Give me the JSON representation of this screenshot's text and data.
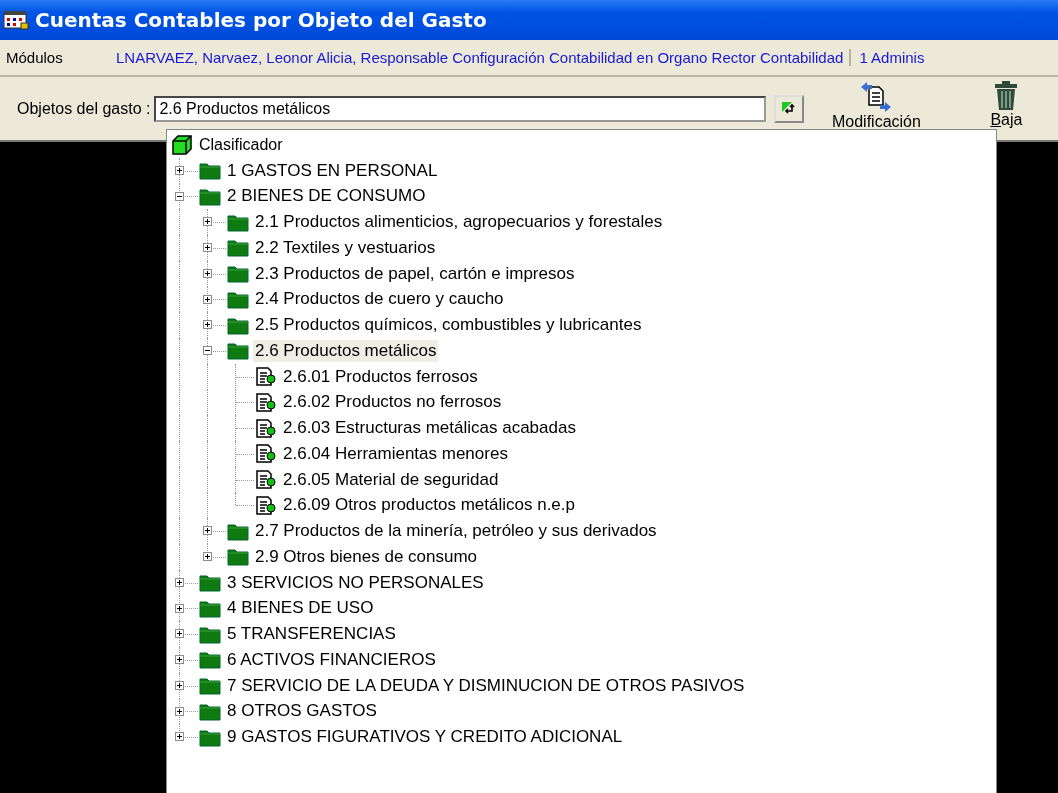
{
  "window": {
    "title": "Cuentas Contables por Objeto del Gasto"
  },
  "menu_bar": {
    "menu": "Módulos",
    "user": "LNARVAEZ, Narvaez, Leonor Alicia, Responsable Configuración Contabilidad en Organo Rector Contabilidad",
    "role": "1 Adminis"
  },
  "toolbar": {
    "field_label": "Objetos del gasto :",
    "field_value": "2.6 Productos metálicos",
    "buttons": [
      {
        "label": "Modificación",
        "kind": "edit"
      },
      {
        "label": "Baja",
        "kind": "delete"
      }
    ]
  },
  "tree": {
    "label": "Clasificador",
    "kind": "root",
    "selected": false,
    "children": [
      {
        "label": "1 GASTOS EN PERSONAL",
        "kind": "folder",
        "selected": false,
        "expanded": false
      },
      {
        "label": "2 BIENES DE CONSUMO",
        "kind": "folder",
        "selected": false,
        "expanded": true,
        "children": [
          {
            "label": "2.1 Productos alimenticios, agropecuarios y forestales",
            "kind": "folder",
            "selected": false,
            "expanded": false
          },
          {
            "label": "2.2 Textiles y vestuarios",
            "kind": "folder",
            "selected": false,
            "expanded": false
          },
          {
            "label": "2.3 Productos de papel, cartón e impresos",
            "kind": "folder",
            "selected": false,
            "expanded": false
          },
          {
            "label": "2.4 Productos de cuero y caucho",
            "kind": "folder",
            "selected": false,
            "expanded": false
          },
          {
            "label": "2.5 Productos químicos, combustibles y lubricantes",
            "kind": "folder",
            "selected": false,
            "expanded": false
          },
          {
            "label": "2.6 Productos metálicos",
            "kind": "folder",
            "selected": true,
            "expanded": true,
            "children": [
              {
                "label": "2.6.01 Productos ferrosos",
                "kind": "leaf",
                "selected": false
              },
              {
                "label": "2.6.02 Productos no ferrosos",
                "kind": "leaf",
                "selected": false
              },
              {
                "label": "2.6.03 Estructuras metálicas acabadas",
                "kind": "leaf",
                "selected": false
              },
              {
                "label": "2.6.04 Herramientas menores",
                "kind": "leaf",
                "selected": false
              },
              {
                "label": "2.6.05 Material de seguridad",
                "kind": "leaf",
                "selected": false
              },
              {
                "label": "2.6.09 Otros productos metálicos n.e.p",
                "kind": "leaf",
                "selected": false
              }
            ]
          },
          {
            "label": "2.7 Productos de la minería, petróleo y sus derivados",
            "kind": "folder",
            "selected": false,
            "expanded": false
          },
          {
            "label": "2.9 Otros bienes de consumo",
            "kind": "folder",
            "selected": false,
            "expanded": false
          }
        ]
      },
      {
        "label": "3 SERVICIOS NO PERSONALES",
        "kind": "folder",
        "selected": false,
        "expanded": false
      },
      {
        "label": "4 BIENES DE USO",
        "kind": "folder",
        "selected": false,
        "expanded": false
      },
      {
        "label": "5 TRANSFERENCIAS",
        "kind": "folder",
        "selected": false,
        "expanded": false
      },
      {
        "label": "6 ACTIVOS FINANCIEROS",
        "kind": "folder",
        "selected": false,
        "expanded": false
      },
      {
        "label": "7 SERVICIO DE LA DEUDA Y DISMINUCION DE OTROS PASIVOS",
        "kind": "folder",
        "selected": false,
        "expanded": false
      },
      {
        "label": "8 OTROS GASTOS",
        "kind": "folder",
        "selected": false,
        "expanded": false
      },
      {
        "label": "9 GASTOS FIGURATIVOS Y CREDITO ADICIONAL",
        "kind": "folder",
        "selected": false,
        "expanded": false
      }
    ]
  }
}
